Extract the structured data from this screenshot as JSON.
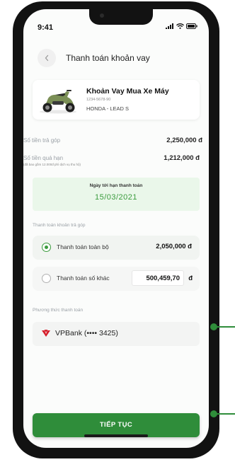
{
  "status_bar": {
    "time": "9:41"
  },
  "header": {
    "title": "Thanh toán khoản vay"
  },
  "loan": {
    "name": "Khoản Vay Mua Xe Máy",
    "code": "1234-5678-90",
    "model": "HONDA - LEAD S"
  },
  "installment": {
    "label": "Số tiền trả góp",
    "value": "2,250,000 đ"
  },
  "overdue": {
    "label": "Số tiền quá hạn",
    "note": "(đã bao gồm 12.000đ phí dịch vụ thu hộ)",
    "value": "1,212,000 đ"
  },
  "due": {
    "label": "Ngày tới hạn thanh toán",
    "date": "15/03/2021"
  },
  "payment_section": {
    "label": "Thanh toán khoản trả góp",
    "options": [
      {
        "label": "Thanh toán toàn bộ",
        "value": "2,050,000 đ",
        "selected": true
      },
      {
        "label": "Thanh toán số khác",
        "value": "500,459,70",
        "currency": "đ",
        "selected": false
      }
    ]
  },
  "method_section": {
    "label": "Phương thức thanh toán",
    "selected": "VPBank (•••• 3425)",
    "icon": "vpbank-logo-icon"
  },
  "cta": {
    "label": "TIẾP TỤC"
  },
  "colors": {
    "accent": "#3a9b3d",
    "button": "#2f8d3a",
    "due_bg": "#eaf7ea"
  }
}
